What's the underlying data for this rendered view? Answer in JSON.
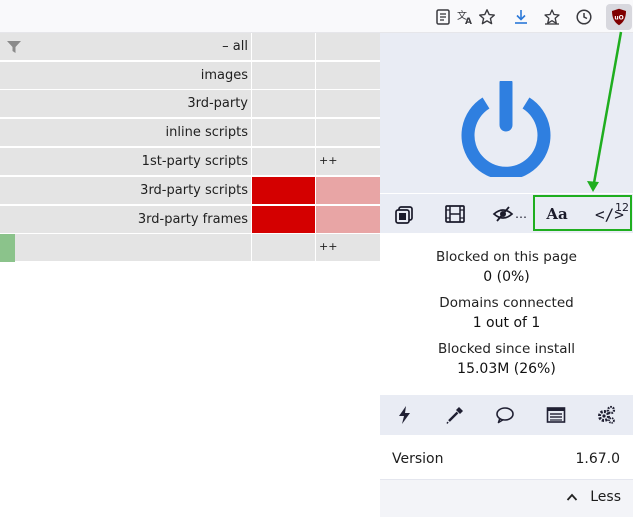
{
  "toolbar": {
    "icons": [
      "reader-view-icon",
      "translate-icon",
      "bookmark-star-icon",
      "download-icon",
      "extensions-icon",
      "history-clock-icon",
      "ublock-origin-icon"
    ]
  },
  "firewall": {
    "rows": [
      {
        "label": "– all",
        "col1": "",
        "col2": ""
      },
      {
        "label": "images",
        "col1": "",
        "col2": ""
      },
      {
        "label": "3rd-party",
        "col1": "",
        "col2": ""
      },
      {
        "label": "inline scripts",
        "col1": "",
        "col2": ""
      },
      {
        "label": "1st-party scripts",
        "col1": "",
        "col2": "++"
      },
      {
        "label": "3rd-party scripts",
        "col1": "",
        "col2": ""
      },
      {
        "label": "3rd-party frames",
        "col1": "",
        "col2": ""
      },
      {
        "label": "",
        "col1": "",
        "col2": "++"
      }
    ]
  },
  "panel": {
    "tools": {
      "popups_icon": "block-popups-icon",
      "media_icon": "film-icon",
      "cosmetic_icon": "eye-slash-icon",
      "cosmetic_suffix": "…",
      "fonts_label": "Aa",
      "scripts_label": "</>",
      "scripts_count": "12"
    },
    "stats": {
      "blocked_page_label": "Blocked on this page",
      "blocked_page_value": "0 (0%)",
      "domains_label": "Domains connected",
      "domains_value": "1 out of 1",
      "blocked_install_label": "Blocked since install",
      "blocked_install_value": "15.03M (26%)"
    },
    "actions": [
      "lightning-icon",
      "eyedropper-icon",
      "speech-bubble-icon",
      "logger-list-icon",
      "settings-gears-icon"
    ],
    "version_label": "Version",
    "version_value": "1.67.0",
    "less_label": "Less"
  },
  "colors": {
    "power_blue": "#2f7fe0",
    "block_red": "#d40000",
    "noop_pink": "#e8a5a5",
    "allow_green": "#8bc38b",
    "annotation_green": "#1fae1f",
    "ubo_red": "#800000"
  }
}
